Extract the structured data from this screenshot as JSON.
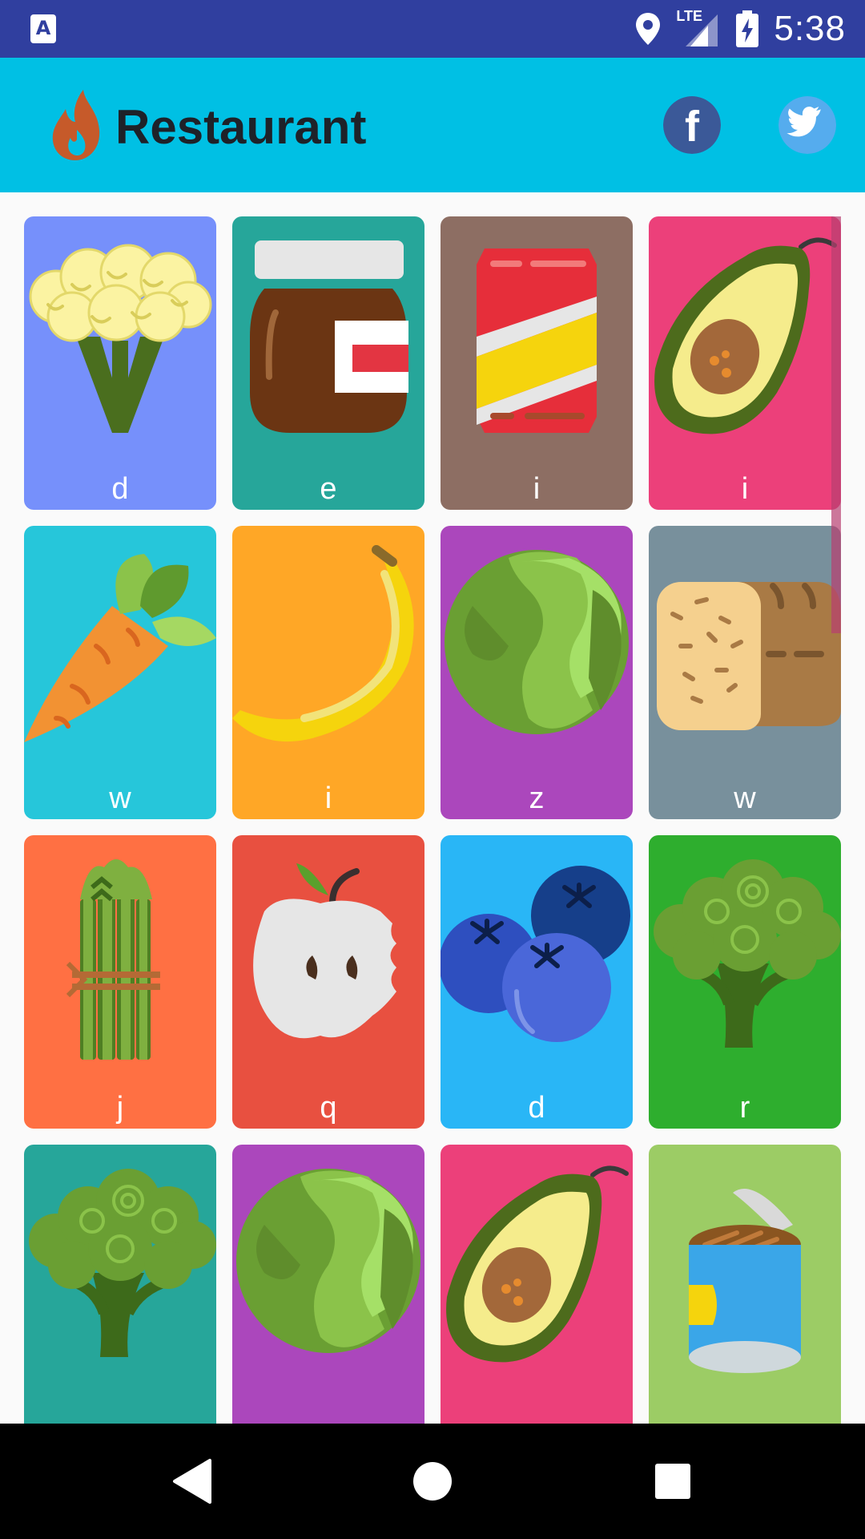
{
  "status_bar": {
    "time": "5:38",
    "network": "LTE",
    "icons": [
      "app-notification-icon",
      "location-icon",
      "signal-icon",
      "battery-charging-icon"
    ]
  },
  "app_bar": {
    "title": "Restaurant",
    "logo_icon": "flame-icon",
    "social_buttons": [
      {
        "name": "facebook",
        "label": "f",
        "color": "#3b5998"
      },
      {
        "name": "twitter",
        "color": "#55acee"
      }
    ]
  },
  "colors": {
    "status_bar": "#303f9f",
    "app_bar": "#00c0e4",
    "background": "#fafafa"
  },
  "tiles": [
    {
      "label": "d",
      "icon": "cauliflower-icon",
      "color": "#7690fb"
    },
    {
      "label": "e",
      "icon": "chocolate-jar-icon",
      "color": "#26a69a"
    },
    {
      "label": "i",
      "icon": "soda-can-icon",
      "color": "#8d6e63"
    },
    {
      "label": "i",
      "icon": "avocado-icon",
      "color": "#ec407a"
    },
    {
      "label": "w",
      "icon": "carrot-icon",
      "color": "#26c6da"
    },
    {
      "label": "i",
      "icon": "banana-icon",
      "color": "#ffa726"
    },
    {
      "label": "z",
      "icon": "cabbage-icon",
      "color": "#ab47bc"
    },
    {
      "label": "w",
      "icon": "bread-icon",
      "color": "#78909c"
    },
    {
      "label": "j",
      "icon": "asparagus-icon",
      "color": "#ff7043"
    },
    {
      "label": "q",
      "icon": "apple-icon",
      "color": "#e85040"
    },
    {
      "label": "d",
      "icon": "blueberries-icon",
      "color": "#29b6f6"
    },
    {
      "label": "r",
      "icon": "broccoli-icon",
      "color": "#2eae2e"
    },
    {
      "label": "",
      "icon": "broccoli-icon",
      "color": "#26a69a"
    },
    {
      "label": "",
      "icon": "cabbage-icon",
      "color": "#ab47bc"
    },
    {
      "label": "",
      "icon": "avocado-icon",
      "color": "#ec407a"
    },
    {
      "label": "",
      "icon": "canned-food-icon",
      "color": "#9ccc65"
    }
  ],
  "nav_bar": {
    "buttons": [
      "back-icon",
      "home-icon",
      "recents-icon"
    ]
  }
}
